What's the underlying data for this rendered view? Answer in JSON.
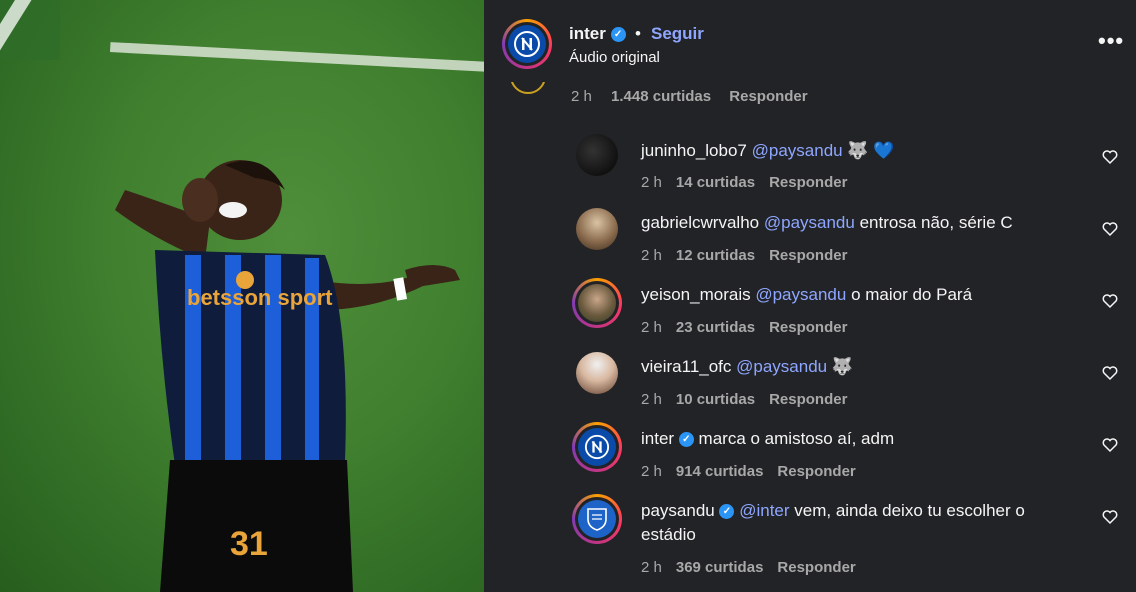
{
  "post": {
    "username": "inter",
    "follow_label": "Seguir",
    "separator": "•",
    "audio": "Áudio original",
    "more_icon": "more-horizontal-icon"
  },
  "parent_comment_meta": {
    "time": "2 h",
    "likes": "1.448 curtidas",
    "reply": "Responder"
  },
  "comments": [
    {
      "username": "juninho_lobo7",
      "mention": "@paysandu",
      "text": " 🐺 💙",
      "time": "2 h",
      "likes": "14 curtidas",
      "reply": "Responder",
      "verified": false
    },
    {
      "username": "gabrielcwrvalho",
      "mention": "@paysandu",
      "text": " entrosa não, série C",
      "time": "2 h",
      "likes": "12 curtidas",
      "reply": "Responder",
      "verified": false
    },
    {
      "username": "yeison_morais",
      "mention": "@paysandu",
      "text": " o maior do Pará",
      "time": "2 h",
      "likes": "23 curtidas",
      "reply": "Responder",
      "verified": false
    },
    {
      "username": "vieira11_ofc",
      "mention": "@paysandu",
      "text": " 🐺",
      "time": "2 h",
      "likes": "10 curtidas",
      "reply": "Responder",
      "verified": false
    },
    {
      "username": "inter",
      "mention": "",
      "text": "marca o amistoso aí, adm",
      "time": "2 h",
      "likes": "914 curtidas",
      "reply": "Responder",
      "verified": true
    },
    {
      "username": "paysandu",
      "mention": "@inter",
      "text": " vem, ainda deixo tu escolher o estádio",
      "time": "2 h",
      "likes": "369 curtidas",
      "reply": "Responder",
      "verified": true
    }
  ],
  "media": {
    "jersey_text": "betsson sport",
    "jersey_number": "31"
  },
  "colors": {
    "panel_bg": "#222326",
    "mention": "#8ea6ff",
    "verified": "#2b95f5",
    "muted": "#a8a8a8"
  }
}
